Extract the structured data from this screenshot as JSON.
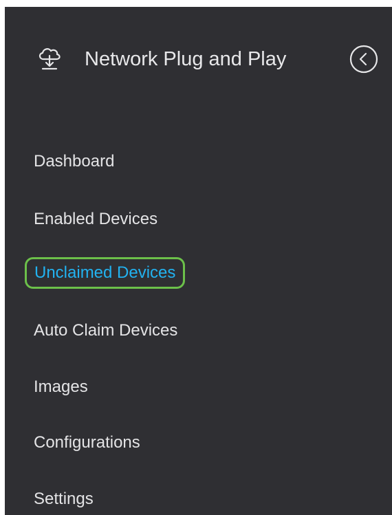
{
  "header": {
    "title": "Network Plug and Play",
    "app_icon": "cloud-download-icon",
    "collapse_icon": "chevron-left-circle-icon"
  },
  "nav": {
    "items": [
      {
        "label": "Dashboard",
        "active": false
      },
      {
        "label": "Enabled Devices",
        "active": false
      },
      {
        "label": "Unclaimed Devices",
        "active": true
      },
      {
        "label": "Auto Claim Devices",
        "active": false
      },
      {
        "label": "Images",
        "active": false
      },
      {
        "label": "Configurations",
        "active": false
      },
      {
        "label": "Settings",
        "active": false
      }
    ]
  },
  "colors": {
    "panel_background": "#2f2f33",
    "text": "#e4e4e6",
    "active_text": "#22b2f0",
    "highlight_border": "#6cc04a"
  }
}
